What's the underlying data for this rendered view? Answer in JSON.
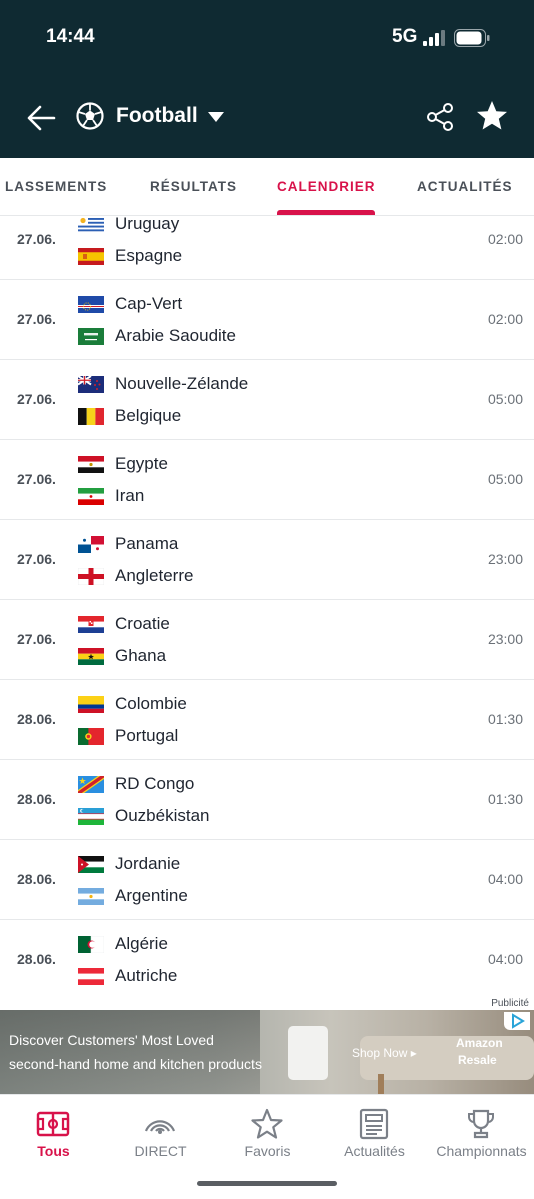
{
  "status_bar": {
    "time": "14:44",
    "network": "5G"
  },
  "header": {
    "title": "Football",
    "icons": {
      "back": "arrow-left-icon",
      "sport": "soccer-ball-icon",
      "dropdown": "caret-down-icon",
      "share": "share-icon",
      "favorite": "star-icon"
    }
  },
  "tabs": [
    {
      "label": "LASSEMENTS",
      "active": false
    },
    {
      "label": "RÉSULTATS",
      "active": false
    },
    {
      "label": "CALENDRIER",
      "active": true
    },
    {
      "label": "ACTUALITÉS",
      "active": false
    }
  ],
  "matches": [
    {
      "date": "27.06.",
      "time": "02:00",
      "home": "Uruguay",
      "away": "Espagne",
      "home_flag": "uruguay",
      "away_flag": "spain"
    },
    {
      "date": "27.06.",
      "time": "02:00",
      "home": "Cap-Vert",
      "away": "Arabie Saoudite",
      "home_flag": "cape-verde",
      "away_flag": "saudi-arabia"
    },
    {
      "date": "27.06.",
      "time": "05:00",
      "home": "Nouvelle-Zélande",
      "away": "Belgique",
      "home_flag": "new-zealand",
      "away_flag": "belgium"
    },
    {
      "date": "27.06.",
      "time": "05:00",
      "home": "Egypte",
      "away": "Iran",
      "home_flag": "egypt",
      "away_flag": "iran"
    },
    {
      "date": "27.06.",
      "time": "23:00",
      "home": "Panama",
      "away": "Angleterre",
      "home_flag": "panama",
      "away_flag": "england"
    },
    {
      "date": "27.06.",
      "time": "23:00",
      "home": "Croatie",
      "away": "Ghana",
      "home_flag": "croatia",
      "away_flag": "ghana"
    },
    {
      "date": "28.06.",
      "time": "01:30",
      "home": "Colombie",
      "away": "Portugal",
      "home_flag": "colombia",
      "away_flag": "portugal"
    },
    {
      "date": "28.06.",
      "time": "01:30",
      "home": "RD Congo",
      "away": "Ouzbékistan",
      "home_flag": "dr-congo",
      "away_flag": "uzbekistan"
    },
    {
      "date": "28.06.",
      "time": "04:00",
      "home": "Jordanie",
      "away": "Argentine",
      "home_flag": "jordan",
      "away_flag": "argentina"
    },
    {
      "date": "28.06.",
      "time": "04:00",
      "home": "Algérie",
      "away": "Autriche",
      "home_flag": "algeria",
      "away_flag": "austria"
    }
  ],
  "ad": {
    "label": "Publicité",
    "line1": "Discover Customers' Most Loved",
    "line2": "second-hand home and kitchen products",
    "cta": "Shop Now ▸",
    "brand_line1": "Amazon",
    "brand_line2": "Resale"
  },
  "bottom_nav": [
    {
      "label": "Tous",
      "icon": "pitch-icon",
      "active": true
    },
    {
      "label": "DIRECT",
      "icon": "live-broadcast-icon",
      "active": false
    },
    {
      "label": "Favoris",
      "icon": "star-outline-icon",
      "active": false
    },
    {
      "label": "Actualités",
      "icon": "newspaper-icon",
      "active": false
    },
    {
      "label": "Championnats",
      "icon": "trophy-icon",
      "active": false
    }
  ],
  "colors": {
    "header_bg": "#0f2a32",
    "accent": "#d8124a",
    "text": "#1f2530",
    "muted": "#6b7178"
  }
}
